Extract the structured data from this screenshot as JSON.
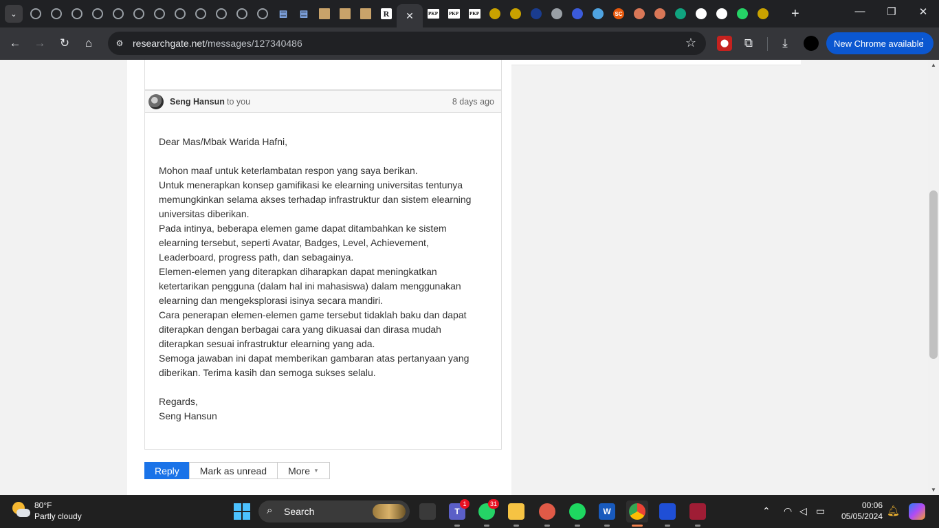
{
  "browser": {
    "tabs": [
      {
        "icon": "researchgate-icon"
      },
      {
        "icon": "researchgate-icon"
      },
      {
        "icon": "researchgate-icon"
      },
      {
        "icon": "researchgate-icon"
      },
      {
        "icon": "researchgate-icon"
      },
      {
        "icon": "researchgate-icon"
      },
      {
        "icon": "researchgate-icon"
      },
      {
        "icon": "researchgate-icon"
      },
      {
        "icon": "researchgate-icon"
      },
      {
        "icon": "researchgate-icon"
      },
      {
        "icon": "researchgate-icon"
      },
      {
        "icon": "researchgate-icon"
      },
      {
        "icon": "document-icon"
      },
      {
        "icon": "document-icon"
      },
      {
        "icon": "image-icon"
      },
      {
        "icon": "image-icon"
      },
      {
        "icon": "image-icon"
      },
      {
        "icon": "researchgate-logo-icon",
        "text": "R"
      },
      {
        "icon": "close-icon",
        "active": true
      },
      {
        "icon": "pkp-icon",
        "text": "PKP"
      },
      {
        "icon": "pkp-icon",
        "text": "PKP"
      },
      {
        "icon": "pkp-icon",
        "text": "PKP"
      },
      {
        "icon": "university-seal-icon"
      },
      {
        "icon": "university-seal-icon"
      },
      {
        "icon": "institution-icon"
      },
      {
        "icon": "diamond-icon"
      },
      {
        "icon": "globe-icon"
      },
      {
        "icon": "network-icon"
      },
      {
        "icon": "sc-icon",
        "text": "SC"
      },
      {
        "icon": "claude-icon"
      },
      {
        "icon": "claude-icon"
      },
      {
        "icon": "chatgpt-icon"
      },
      {
        "icon": "copilot-icon"
      },
      {
        "icon": "scholar-icon"
      },
      {
        "icon": "whatsapp-icon"
      },
      {
        "icon": "seal-icon"
      }
    ],
    "colors": {
      "pkp": "#ffffff",
      "seal": "#c9a200",
      "institution": "#1a3c8f",
      "globe": "#3b5bdb",
      "network": "#4fa3e0",
      "sc": "#e8590c",
      "claude": "#d97757",
      "chatgpt": "#10a37f",
      "copilot": "#ffffff",
      "scholar": "#ffffff",
      "whatsapp": "#25d366"
    },
    "address": {
      "domain": "researchgate.net",
      "path": "/messages/127340486"
    },
    "update_button": "New Chrome available"
  },
  "message": {
    "sender": "Seng Hansun",
    "recipient": "to you",
    "date": "8 days ago",
    "body": [
      "Dear Mas/Mbak Warida Hafni,",
      "",
      "Mohon maaf untuk keterlambatan respon yang saya berikan.",
      "Untuk menerapkan konsep gamifikasi ke elearning universitas tentunya memungkinkan selama akses terhadap infrastruktur dan sistem elearning universitas diberikan.",
      "Pada intinya, beberapa elemen game dapat ditambahkan ke sistem elearning tersebut, seperti Avatar, Badges, Level, Achievement, Leaderboard, progress path, dan sebagainya.",
      "Elemen-elemen yang diterapkan diharapkan dapat meningkatkan ketertarikan pengguna (dalam hal ini mahasiswa) dalam menggunakan elearning dan mengeksplorasi isinya secara mandiri.",
      "Cara penerapan elemen-elemen game tersebut tidaklah baku dan dapat diterapkan dengan berbagai cara yang dikuasai dan dirasa mudah diterapkan sesuai infrastruktur elearning yang ada.",
      "Semoga jawaban ini dapat memberikan gambaran atas pertanyaan yang diberikan. Terima kasih dan semoga sukses selalu.",
      "",
      "Regards,",
      "Seng Hansun"
    ]
  },
  "actions": {
    "reply": "Reply",
    "mark_unread": "Mark as unread",
    "more": "More"
  },
  "taskbar": {
    "weather": {
      "temp": "80°F",
      "condition": "Partly cloudy"
    },
    "search_placeholder": "Search",
    "apps": [
      {
        "name": "task-view-icon"
      },
      {
        "name": "teams-icon",
        "badge": "1",
        "text": "T"
      },
      {
        "name": "whatsapp-icon",
        "badge": "31"
      },
      {
        "name": "file-explorer-icon"
      },
      {
        "name": "app-icon"
      },
      {
        "name": "spotify-icon"
      },
      {
        "name": "word-icon",
        "text": "W"
      },
      {
        "name": "chrome-icon",
        "active": true
      },
      {
        "name": "vscode-icon"
      },
      {
        "name": "mendeley-icon"
      }
    ],
    "clock": {
      "time": "00:06",
      "date": "05/05/2024"
    }
  }
}
